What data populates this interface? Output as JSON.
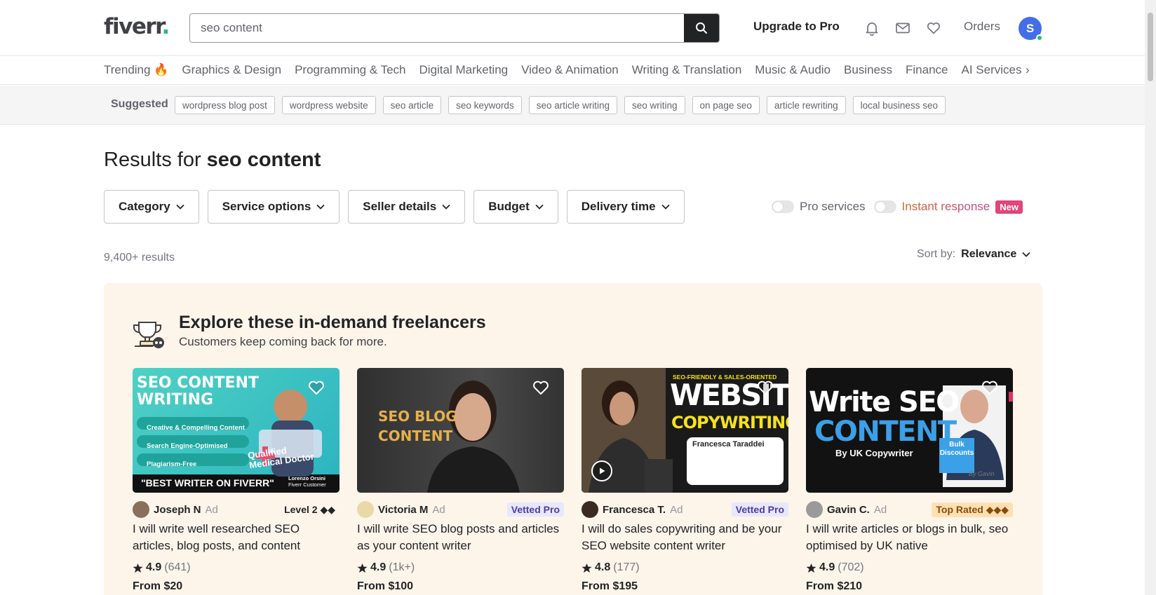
{
  "header": {
    "logo": "fiverr",
    "logo_dot": ".",
    "search_value": "seo content",
    "upgrade_label": "Upgrade to Pro",
    "orders_label": "Orders",
    "avatar_initial": "S"
  },
  "categories": [
    "Trending 🔥",
    "Graphics & Design",
    "Programming & Tech",
    "Digital Marketing",
    "Video & Animation",
    "Writing & Translation",
    "Music & Audio",
    "Business",
    "Finance",
    "AI Services"
  ],
  "suggested": {
    "label": "Suggested",
    "tags": [
      "wordpress blog post",
      "wordpress website",
      "seo article",
      "seo keywords",
      "seo article writing",
      "seo writing",
      "on page seo",
      "article rewriting",
      "local business seo"
    ]
  },
  "results": {
    "prefix": "Results for ",
    "query": "seo content",
    "count": "9,400+ results",
    "sort_label": "Sort by:",
    "sort_value": "Relevance"
  },
  "filters": [
    "Category",
    "Service options",
    "Seller details",
    "Budget",
    "Delivery time"
  ],
  "toggles": {
    "pro_label": "Pro services",
    "instant_label": "Instant response",
    "new_badge": "New"
  },
  "explore": {
    "title": "Explore these in-demand freelancers",
    "subtitle": "Customers keep coming back for more.",
    "cards": [
      {
        "seller": "Joseph N",
        "ad": "Ad",
        "badge": "Level 2 ◆◆",
        "badge_type": "level",
        "title": "I will write well researched SEO articles, blog posts, and content",
        "rating": "4.9",
        "reviews": "(641)",
        "price": "From $20",
        "img": {
          "l1": "SEO CONTENT",
          "l2": "WRITING",
          "b1": "Creative & Compelling Content",
          "b2": "Search Engine-Optimised",
          "b3": "Plagiarism-Free",
          "q1": "Qualified",
          "q2": "Medical Doctor",
          "quote": "\"BEST WRITER ON FIVERR\"",
          "attr1": "Lorenzo Orsini",
          "attr2": "Fiverr Customer"
        }
      },
      {
        "seller": "Victoria M",
        "ad": "Ad",
        "badge": "Vetted Pro",
        "badge_type": "vetted",
        "title": "I will write SEO blog posts and articles as your content writer",
        "rating": "4.9",
        "reviews": "(1k+)",
        "price": "From $100",
        "img": {
          "l1": "SEO BLOG",
          "l2": "CONTENT"
        }
      },
      {
        "seller": "Francesca T.",
        "ad": "Ad",
        "badge": "Vetted Pro",
        "badge_type": "vetted",
        "title": "I will do sales copywriting and be your SEO website content writer",
        "rating": "4.8",
        "reviews": "(177)",
        "price": "From $195",
        "img": {
          "top": "SEO-FRIENDLY & SALES-ORIENTED",
          "l1": "WEBSITE",
          "l2": "COPYWRITING",
          "card_name": "Francesca Taraddei"
        }
      },
      {
        "seller": "Gavin C.",
        "ad": "Ad",
        "badge": "Top Rated ◆◆◆",
        "badge_type": "top",
        "title": "I will write articles or blogs in bulk, seo optimised by UK native",
        "rating": "4.9",
        "reviews": "(702)",
        "price": "From $210",
        "img": {
          "l1": "Write SEO",
          "l2": "CONTENT",
          "l3": "By UK Copywriter",
          "bulk1": "Bulk",
          "bulk2": "Discounts",
          "sig": "By Gavin"
        }
      }
    ]
  },
  "colors": {
    "brand_green": "#1dbf73",
    "search_btn": "#222325",
    "explore_bg": "#fdf4ea",
    "new_badge": "#e0457b"
  }
}
